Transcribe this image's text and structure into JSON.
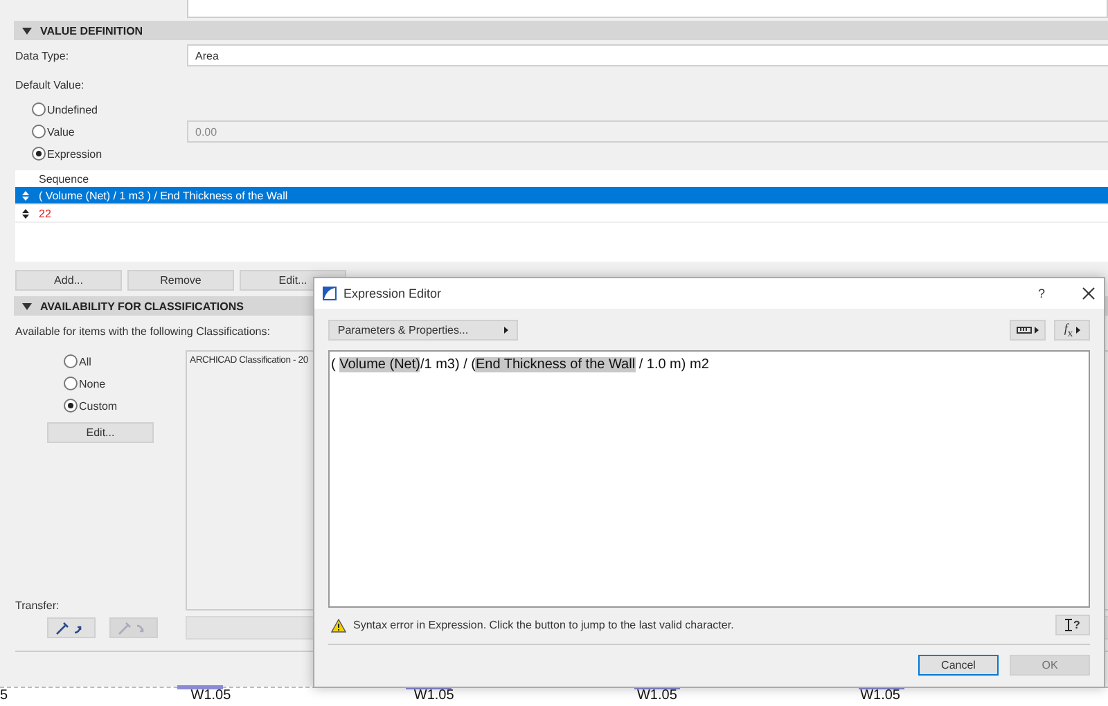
{
  "value_definition": {
    "title": "VALUE DEFINITION",
    "expanded": true,
    "data_type_label": "Data Type:",
    "data_type": "Area",
    "default_value_label": "Default Value:",
    "options": [
      {
        "label": "Undefined",
        "selected": false
      },
      {
        "label": "Value",
        "selected": false
      },
      {
        "label": "Expression",
        "selected": true
      }
    ],
    "value_field": {
      "value": "0.00",
      "disabled": true
    },
    "sequence": {
      "header": "Sequence",
      "rows": [
        {
          "text": "( Volume (Net) / 1 m3 ) / End Thickness of the Wall",
          "selected": true,
          "invalid": false
        },
        {
          "text": "22",
          "selected": false,
          "invalid": true
        }
      ]
    },
    "buttons": [
      "Add...",
      "Remove",
      "Edit..."
    ]
  },
  "classifications": {
    "title": "AVAILABILITY FOR CLASSIFICATIONS",
    "expanded": true,
    "label": "Available for items with the following Classifications:",
    "options": [
      {
        "label": "All",
        "selected": false
      },
      {
        "label": "None",
        "selected": false
      },
      {
        "label": "Custom",
        "selected": true
      }
    ],
    "edit_button": "Edit...",
    "list": [
      "ARCHICAD Classification - 20"
    ]
  },
  "transfer": {
    "label": "Transfer:",
    "buttons": [
      {
        "kind": "pick",
        "disabled": false
      },
      {
        "kind": "inject",
        "disabled": true
      }
    ]
  },
  "canvas": {
    "labels": [
      "5",
      "W1.05",
      "W1.05",
      "W1.05",
      "W1.05"
    ]
  },
  "dialog": {
    "title": "Expression Editor",
    "help": "?",
    "params_button": "Parameters & Properties...",
    "fx_button": "*f*$_{x}$",
    "expression": [
      {
        "text": "( ",
        "highlighted": false
      },
      {
        "text": "Volume (Net)",
        "highlighted": true
      },
      {
        "text": "/1 m3) / (",
        "highlighted": false
      },
      {
        "text": "End Thickness of the Wall",
        "highlighted": true
      },
      {
        "text": " / 1.0 m) m2",
        "highlighted": false
      }
    ],
    "error": "Syntax error in Expression. Click the button to jump to the last valid character.",
    "jump_button": "?",
    "buttons": [
      {
        "label": "Cancel",
        "disabled": false,
        "focused": true
      },
      {
        "label": "OK",
        "disabled": true,
        "focused": false
      }
    ]
  }
}
